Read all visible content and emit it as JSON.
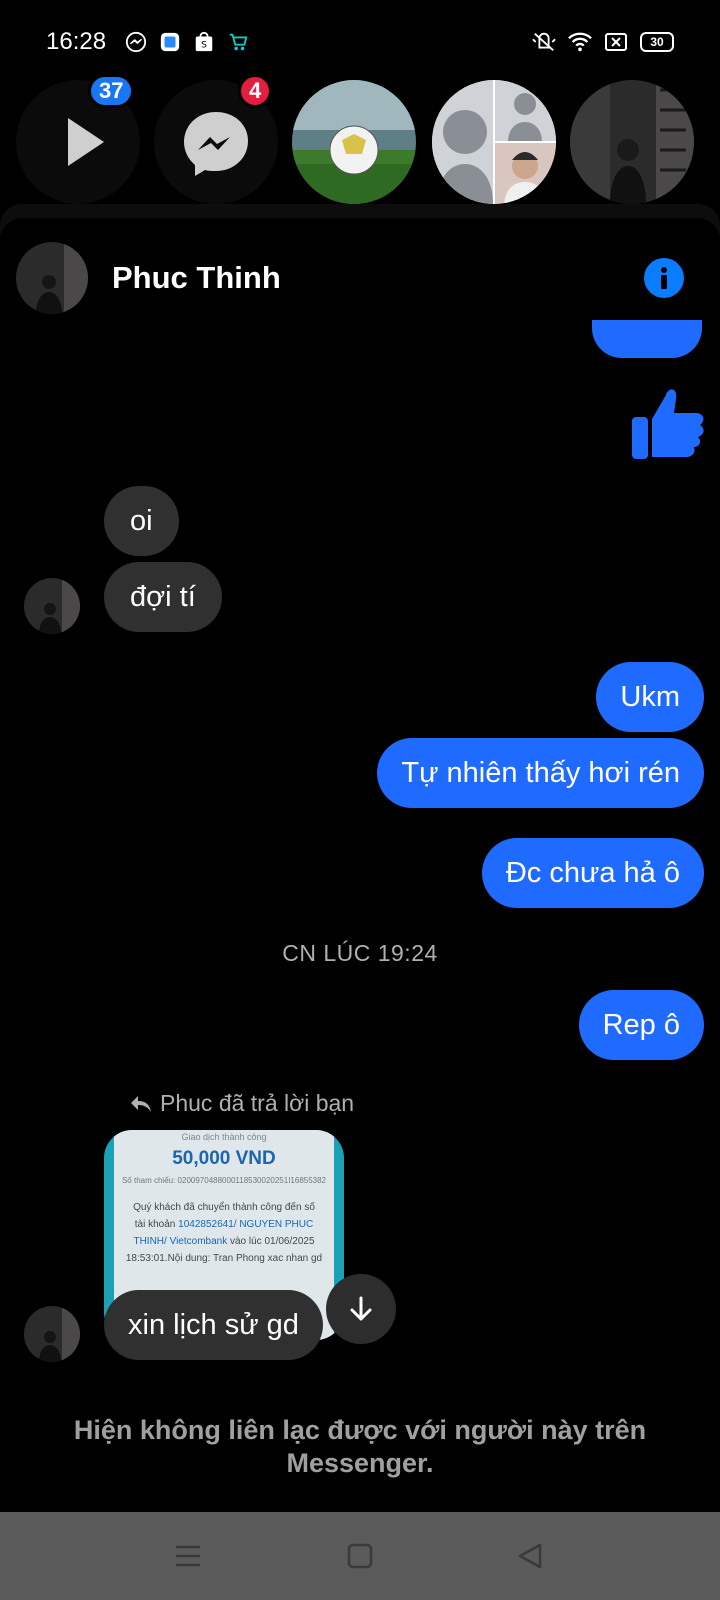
{
  "status_bar": {
    "time": "16:28",
    "battery": "30"
  },
  "chat_heads": {
    "video_badge": "37",
    "messenger_badge": "4"
  },
  "header": {
    "contact_name": "Phuc Thinh"
  },
  "messages": {
    "m_oi": "oi",
    "m_doi_ti": "đợi tí",
    "m_ukm": "Ukm",
    "m_tu_nhien": "Tự nhiên thấy hơi rén",
    "m_dc_chua": "Đc chưa hả ô",
    "timestamp": "CN LÚC 19:24",
    "m_rep": "Rep ô",
    "reply_label": "Phuc đã trả lời bạn",
    "m_xin": "xin lịch sử gd"
  },
  "receipt": {
    "heading": "Giao dịch thành công",
    "amount": "50,000 VND",
    "reference": "Số tham chiếu: 0200970488000118530020251I16855382",
    "line1": "Quý khách đã chuyển thành công đến số",
    "line2_prefix": "tài khoản ",
    "account": "1042852641/ NGUYEN PHUC",
    "line3": "THINH/ Vietcombank",
    "line3_suffix": " vào lúc 01/06/2025",
    "line4": "18:53:01.Nội dung: Tran Phong xac nhan gd"
  },
  "footer": {
    "notice": "Hiện không liên lạc được với người này trên Messenger."
  },
  "colors": {
    "accent": "#1f6bff",
    "incoming": "#303030",
    "badge_red": "#e41e3f",
    "badge_blue": "#1877f2"
  }
}
